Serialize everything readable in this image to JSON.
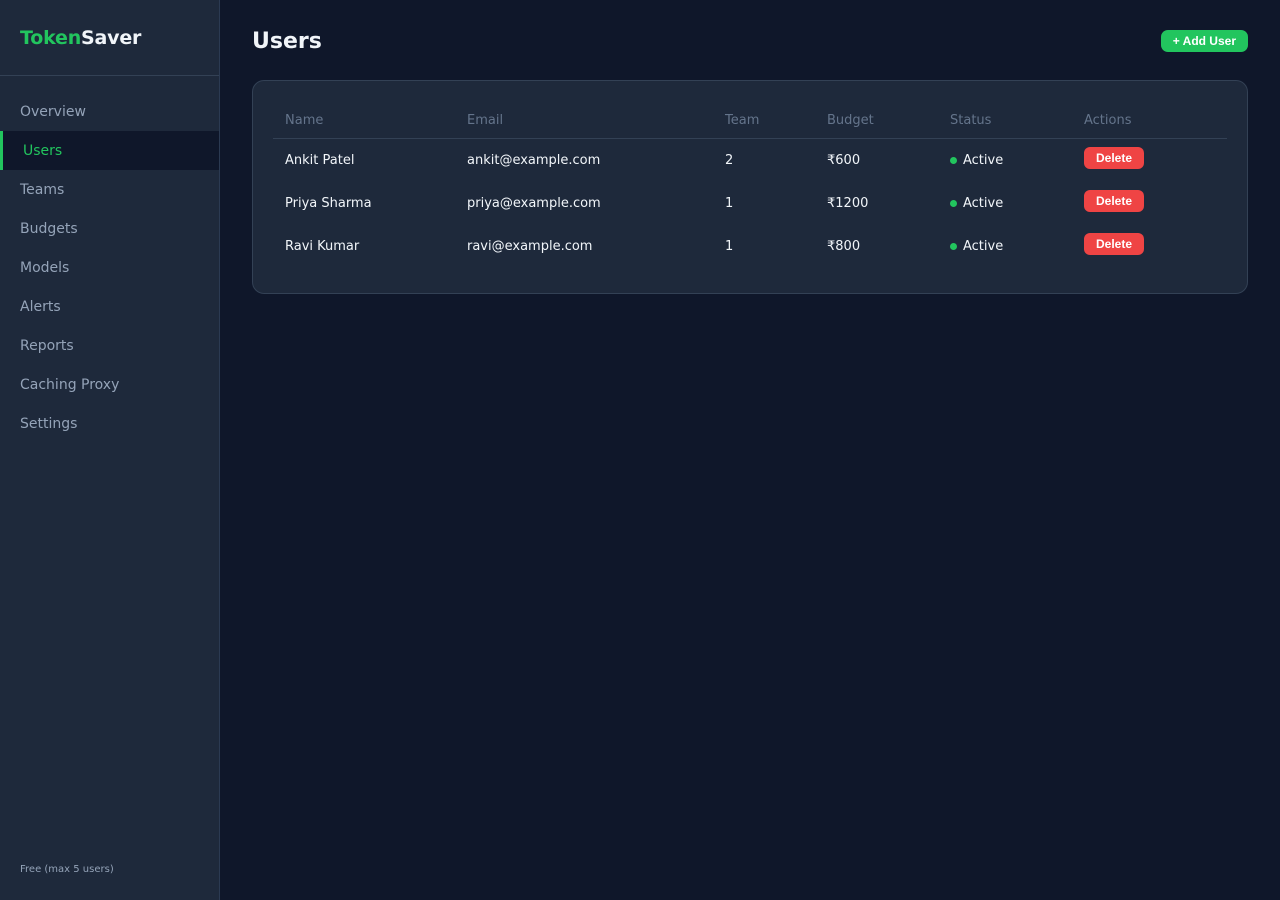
{
  "brand": {
    "part1": "Token",
    "part2": "Saver"
  },
  "sidebar": {
    "items": [
      {
        "label": "Overview"
      },
      {
        "label": "Users"
      },
      {
        "label": "Teams"
      },
      {
        "label": "Budgets"
      },
      {
        "label": "Models"
      },
      {
        "label": "Alerts"
      },
      {
        "label": "Reports"
      },
      {
        "label": "Caching Proxy"
      },
      {
        "label": "Settings"
      }
    ],
    "active_index": 1,
    "plan_note": "Free (max 5 users)"
  },
  "header": {
    "title": "Users",
    "add_button_label": "+ Add User"
  },
  "table": {
    "columns": [
      "Name",
      "Email",
      "Team",
      "Budget",
      "Status",
      "Actions"
    ],
    "rows": [
      {
        "name": "Ankit Patel",
        "email": "ankit@example.com",
        "team": "2",
        "budget": "₹600",
        "status": "Active",
        "action": "Delete"
      },
      {
        "name": "Priya Sharma",
        "email": "priya@example.com",
        "team": "1",
        "budget": "₹1200",
        "status": "Active",
        "action": "Delete"
      },
      {
        "name": "Ravi Kumar",
        "email": "ravi@example.com",
        "team": "1",
        "budget": "₹800",
        "status": "Active",
        "action": "Delete"
      }
    ]
  },
  "colors": {
    "accent": "#22c55e",
    "danger": "#ef4444",
    "background": "#0f172a",
    "panel": "#1e293b"
  }
}
